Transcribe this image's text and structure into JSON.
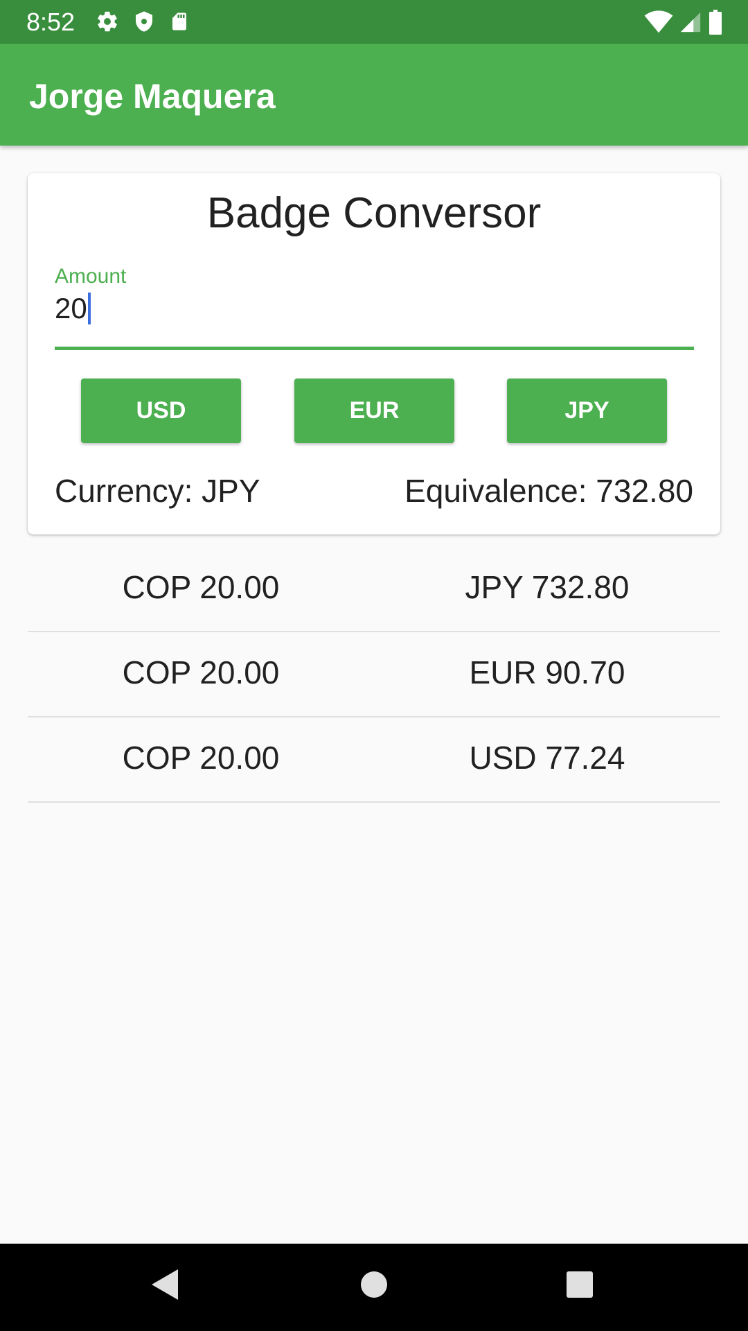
{
  "status_bar": {
    "time": "8:52",
    "left_icons": [
      "gear-icon",
      "shield-icon",
      "sd-card-icon"
    ],
    "right_icons": [
      "wifi-icon",
      "cellular-signal-icon",
      "battery-icon"
    ],
    "color": "#388e3c"
  },
  "app_bar": {
    "title": "Jorge Maquera",
    "color": "#4caf50"
  },
  "converter": {
    "title": "Badge Conversor",
    "amount_label": "Amount",
    "amount_value": "20",
    "buttons": [
      {
        "label": "USD"
      },
      {
        "label": "EUR"
      },
      {
        "label": "JPY"
      }
    ],
    "currency_text": "Currency: JPY",
    "equivalence_text": "Equivalence: 732.80"
  },
  "history": [
    {
      "from": "COP 20.00",
      "to": "JPY 732.80"
    },
    {
      "from": "COP 20.00",
      "to": "EUR 90.70"
    },
    {
      "from": "COP 20.00",
      "to": "USD 77.24"
    }
  ],
  "nav_bar": {
    "buttons": [
      "back-icon",
      "home-icon",
      "recents-icon"
    ]
  }
}
